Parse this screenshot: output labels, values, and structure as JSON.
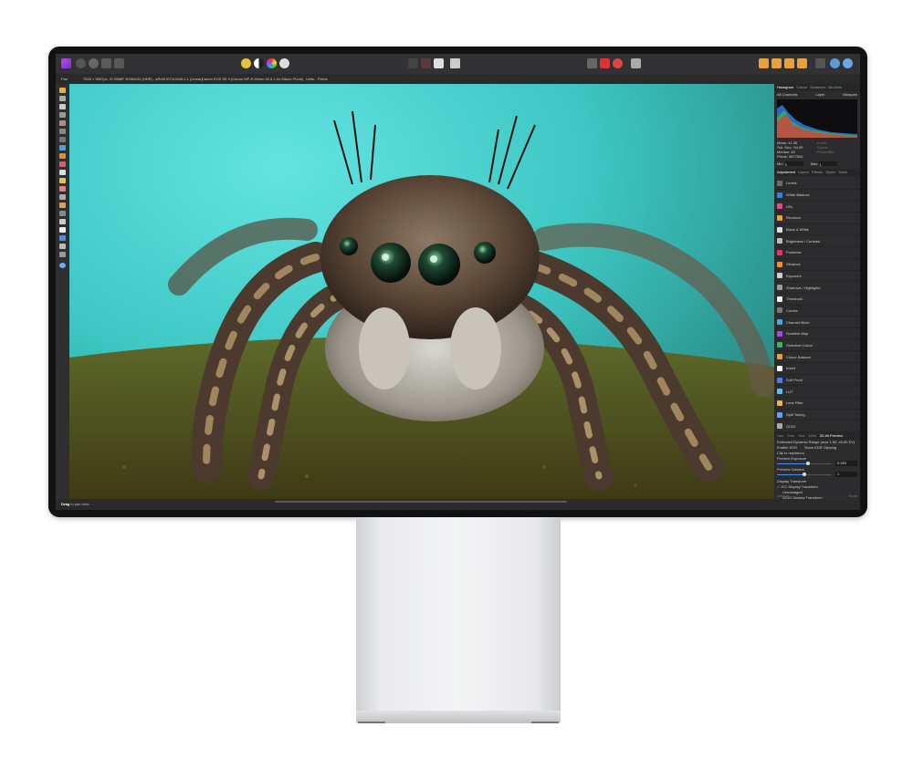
{
  "toolbar": {
    "icons": [
      "affinity-photo-logo",
      "develop-persona-icon",
      "liquify-persona-icon",
      "tone-mapping-persona-icon",
      "export-persona-icon",
      "view-mode-icon",
      "color-wheel-icon",
      "quick-mask-icon",
      "snapping-icon",
      "order-icon",
      "arrange-icon",
      "insert-icon",
      "assistant-icon",
      "help-icon"
    ]
  },
  "context_bar": {
    "label": "Pan",
    "doc_info": "7526 × 5557px, 37.89MP, RGBA/32 (HDR) - sRGB IEC61966-2.1 (Linear)",
    "camera": "Canon EOS 5D II (Canon MP-E 65mm f/2.8 1-5x Macro Photo)",
    "units_label": "Units:",
    "units_value": "Pixels"
  },
  "status_bar": {
    "action": "Drag",
    "hint": "to pan view."
  },
  "panel": {
    "top_tabs": [
      "Histogram",
      "Colour",
      "Swatches",
      "Brushes"
    ],
    "histogram": {
      "channel": "All Channels",
      "layer_label": "Layer",
      "marquee_label": "Marquee",
      "stats_left": [
        "Mean: 41.36",
        "Std. Dev.: 54.09",
        "Median: 40",
        "Pixels: 5877600"
      ],
      "stats_right": [
        "Level:",
        "Count:",
        "Percentile:"
      ],
      "min_label": "Min:",
      "min_value": "0",
      "max_label": "Max:",
      "max_value": "1"
    },
    "adj_tabs": [
      "Adjustment",
      "Layers",
      "Effects",
      "Styles",
      "Stock"
    ],
    "adjustments": [
      {
        "label": "Levels",
        "color": "#6a6a6a"
      },
      {
        "label": "White Balance",
        "color": "#3b7dd8"
      },
      {
        "label": "HSL",
        "color": "#e04a8a"
      },
      {
        "label": "Recolour",
        "color": "#f0a030"
      },
      {
        "label": "Black & White",
        "color": "#dddddd"
      },
      {
        "label": "Brightness / Contrast",
        "color": "#bbbbbb"
      },
      {
        "label": "Posterise",
        "color": "#e6336a"
      },
      {
        "label": "Vibrance",
        "color": "#f0902a"
      },
      {
        "label": "Exposure",
        "color": "#cccccc"
      },
      {
        "label": "Shadows / Highlights",
        "color": "#9a9a9a"
      },
      {
        "label": "Threshold",
        "color": "#eeeeee"
      },
      {
        "label": "Curves",
        "color": "#777777"
      },
      {
        "label": "Channel Mixer",
        "color": "#4aa7e0"
      },
      {
        "label": "Gradient Map",
        "color": "#a24be0"
      },
      {
        "label": "Selective Colour",
        "color": "#3cb36c"
      },
      {
        "label": "Colour Balance",
        "color": "#e0a23c"
      },
      {
        "label": "Invert",
        "color": "#ffffff"
      },
      {
        "label": "Soft Proof",
        "color": "#4a7de0"
      },
      {
        "label": "LUT",
        "color": "#57c1e8"
      },
      {
        "label": "Lens Filter",
        "color": "#e8b24c"
      },
      {
        "label": "Split Toning",
        "color": "#6c9ee8"
      },
      {
        "label": "OCIO",
        "color": "#aaaaaa"
      }
    ],
    "preview_tabs": [
      "Nav",
      "Trfm",
      "Hist",
      "32bit",
      "32-bit Preview"
    ],
    "edr_title": "Extended Dynamic Range (max 1.60, x0.00 EV)",
    "enable_edr": "Enable EDR",
    "show_edr_clipping": "Show EDR Clipping",
    "clip_to_maximum": "Clip to maximum",
    "preview_exposure_label": "Preview Exposure",
    "preview_exposure_value": "0.283",
    "preview_gamma_label": "Preview Gamma",
    "preview_gamma_value": "1",
    "display_transform_label": "Display Transform",
    "icc_display": "ICC Display Transform",
    "unmanaged": "Unmanaged",
    "ocio_display": "OCIO Display Transform",
    "footer_left": "Default",
    "footer_right": "None"
  }
}
